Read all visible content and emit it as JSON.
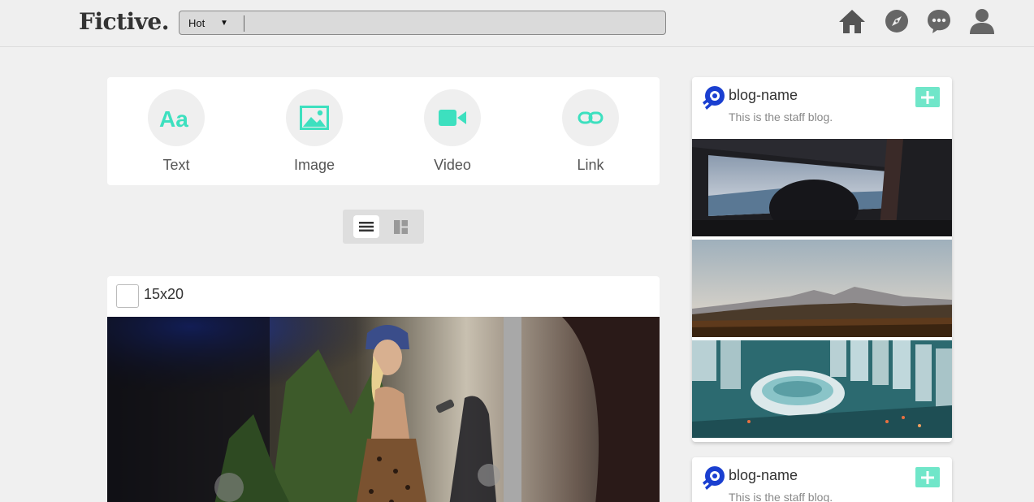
{
  "header": {
    "logo": "Fictive.",
    "search": {
      "filter_value": "Hot",
      "placeholder": ""
    },
    "nav": [
      "home-icon",
      "explore-icon",
      "chat-icon",
      "account-icon"
    ]
  },
  "composer": {
    "types": [
      {
        "label": "Text",
        "icon": "text-icon"
      },
      {
        "label": "Image",
        "icon": "image-icon"
      },
      {
        "label": "Video",
        "icon": "video-icon"
      },
      {
        "label": "Link",
        "icon": "link-icon"
      }
    ]
  },
  "view_toggle": {
    "selected": "list",
    "options": [
      "list",
      "grid"
    ]
  },
  "post": {
    "title": "15x20"
  },
  "sidebar": {
    "cards": [
      {
        "name": "blog-name",
        "description": "This is the staff blog."
      },
      {
        "name": "blog-name",
        "description": "This is the staff blog."
      }
    ]
  },
  "colors": {
    "accent": "#3de0bf",
    "follow_bg": "#70e6c9",
    "blog_avatar": "#1a3fd0"
  }
}
